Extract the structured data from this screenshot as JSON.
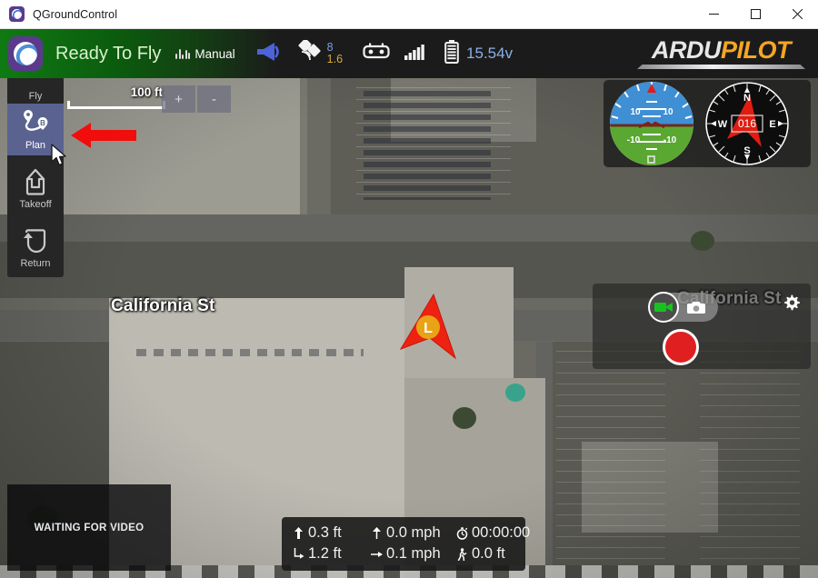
{
  "window": {
    "title": "QGroundControl",
    "app_icon": "qgroundcontrol-icon",
    "minimize_label": "—",
    "maximize_label": "□",
    "close_label": "✕"
  },
  "toolbar": {
    "flight_status": "Ready To Fly",
    "flight_mode": "Manual",
    "flight_mode_icon": "flight-mode-icon",
    "message_icon": "message-megaphone-icon",
    "gps_icon": "satellite-icon",
    "gps_sat_count": "8",
    "gps_hdop": "1.6",
    "rc_icon": "rc-controller-icon",
    "telemetry_icon": "signal-bars-icon",
    "battery_icon": "battery-icon",
    "battery_value": "15.54v",
    "brand_part1": "ARDU",
    "brand_part2": "PILOT",
    "colors": {
      "status_bg_green": "#0f7a12",
      "toolbar_bg": "#1b1b1b",
      "sat_count": "#7c9fe0",
      "hdop": "#d8a93c",
      "battery_text": "#8bb0e8",
      "brand_accent": "#f5a623"
    }
  },
  "menu": {
    "items": [
      {
        "label": "Fly",
        "icon": "fly-icon",
        "selected": false
      },
      {
        "label": "Plan",
        "icon": "plan-route-icon",
        "selected": true
      },
      {
        "label": "Takeoff",
        "icon": "takeoff-arrow-icon",
        "selected": false
      },
      {
        "label": "Return",
        "icon": "return-to-home-icon",
        "selected": false
      }
    ],
    "selected_color": "#5a6290"
  },
  "map": {
    "scale_label": "100 ft",
    "zoom_in_label": "+",
    "zoom_out_label": "-",
    "street_label_left": "California St",
    "street_label_right": "California St",
    "vehicle_marker": "vehicle-heading-arrow",
    "home_marker_label": "L"
  },
  "instruments": {
    "attitude": {
      "pitch_up_left": "10",
      "pitch_up_right": "10",
      "pitch_down_left": "-10",
      "pitch_down_right": "-10"
    },
    "compass": {
      "heading": "016",
      "north": "N",
      "east": "E",
      "south": "S",
      "west": "W"
    }
  },
  "camera": {
    "video_mode_icon": "video-camera-icon",
    "photo_mode_icon": "photo-camera-icon",
    "record_button": "record-button",
    "settings_icon": "gear-icon",
    "active_mode": "video"
  },
  "video": {
    "status_text": "WAITING FOR VIDEO"
  },
  "telemetry": {
    "rows": [
      {
        "icon": "altitude-icon",
        "glyph": "⬆",
        "value": "0.3 ft"
      },
      {
        "icon": "vertical-speed-icon",
        "glyph": "↑",
        "value": "0.0 mph"
      },
      {
        "icon": "flight-time-icon",
        "glyph": "⏱",
        "value": "00:00:00"
      },
      {
        "icon": "distance-icon",
        "glyph": "↳",
        "value": "1.2 ft"
      },
      {
        "icon": "ground-speed-icon",
        "glyph": "→",
        "value": "0.1 mph"
      },
      {
        "icon": "distance-to-home-icon",
        "glyph": "Ὣ6",
        "value": "0.0 ft"
      }
    ]
  }
}
